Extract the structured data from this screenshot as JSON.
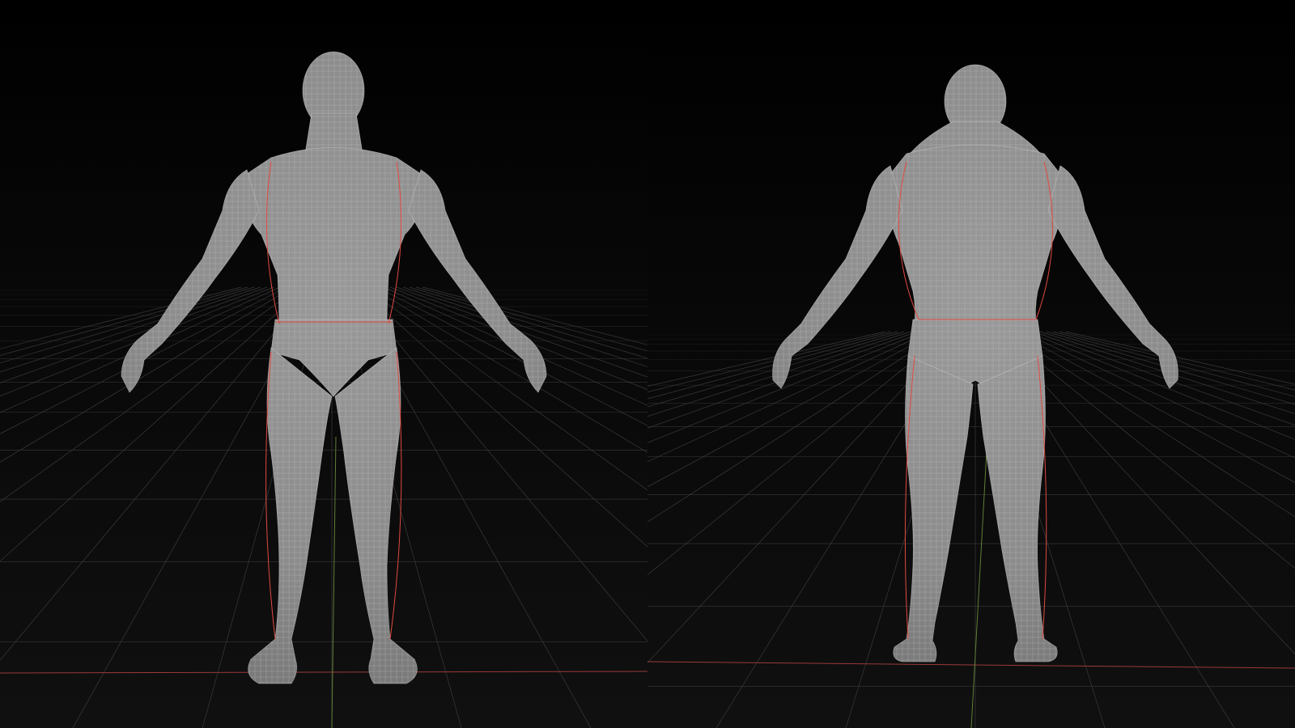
{
  "scene": {
    "background_color": "#040404",
    "grid_color": "#3a3a3a",
    "x_axis_color": "#b04040",
    "y_axis_color": "#6a8a3a",
    "mesh_fill_color": "#8c8c8c",
    "wire_color": "#d8d8d8",
    "seam_color": "#e04a40"
  },
  "viewports": [
    {
      "view": "front"
    },
    {
      "view": "back"
    }
  ],
  "icons": {
    "mesh_front": "human-body-front-icon",
    "mesh_back": "human-body-back-icon"
  }
}
